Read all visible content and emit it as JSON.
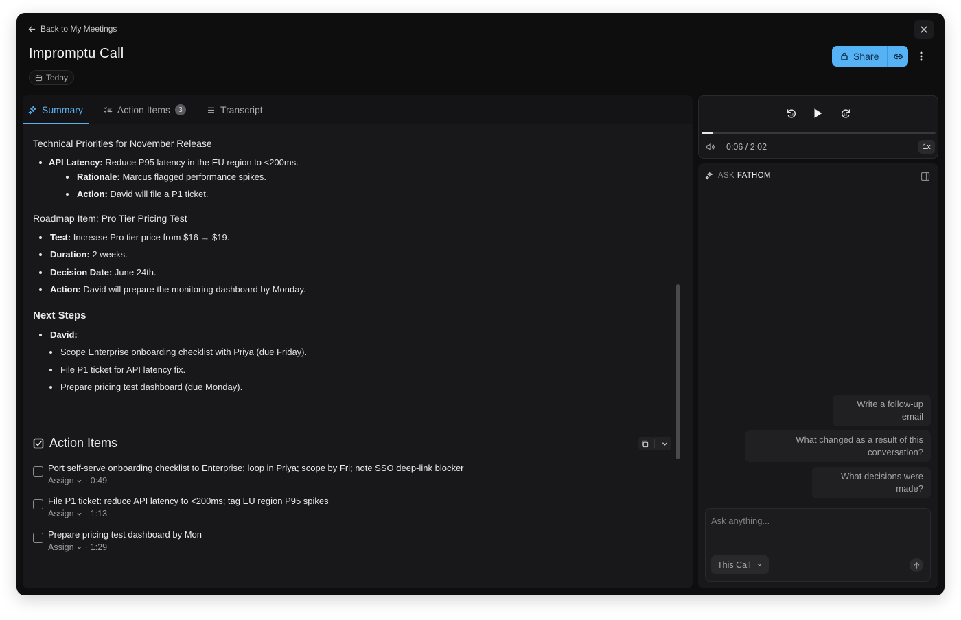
{
  "header": {
    "back_label": "Back to My Meetings",
    "title": "Impromptu Call",
    "date_chip": "Today",
    "share_label": "Share"
  },
  "tabs": [
    {
      "label": "Summary",
      "icon": "sparkle-icon",
      "active": true
    },
    {
      "label": "Action Items",
      "icon": "checklist-icon",
      "badge": "3"
    },
    {
      "label": "Transcript",
      "icon": "lines-icon"
    }
  ],
  "summary": {
    "sections": [
      {
        "heading": "Technical Priorities for November Release",
        "items": [
          {
            "bold": "API Latency:",
            "text": " Reduce P95 latency in the EU region to <200ms."
          }
        ],
        "subitems": [
          {
            "bold": "Rationale:",
            "text": " Marcus flagged performance spikes."
          },
          {
            "bold": "Action:",
            "text": " David will file a P1 ticket."
          }
        ]
      },
      {
        "heading": "Roadmap Item: Pro Tier Pricing Test",
        "items": [
          {
            "bold": "Test:",
            "text": " Increase Pro tier price from $16 → $19."
          },
          {
            "bold": "Duration:",
            "text": " 2 weeks."
          },
          {
            "bold": "Decision Date:",
            "text": " June 24th."
          },
          {
            "bold": "Action:",
            "text": " David will prepare the monitoring dashboard by Monday."
          }
        ]
      },
      {
        "heading": "Next Steps",
        "items": [
          {
            "bold": "David:",
            "text": ""
          }
        ],
        "subitems": [
          {
            "bold": "",
            "text": "Scope Enterprise onboarding checklist with Priya (due Friday)."
          },
          {
            "bold": "",
            "text": "File P1 ticket for API latency fix."
          },
          {
            "bold": "",
            "text": "Prepare pricing test dashboard (due Monday)."
          }
        ]
      }
    ]
  },
  "action_items": {
    "heading": "Action Items",
    "items": [
      {
        "text": "Port self-serve onboarding checklist to Enterprise; loop in Priya; scope by Fri; note SSO deep-link blocker",
        "assign": "Assign",
        "sep": "·",
        "time": "0:49"
      },
      {
        "text": "File P1 ticket: reduce API latency to <200ms; tag EU region P95 spikes",
        "assign": "Assign",
        "sep": "·",
        "time": "1:13"
      },
      {
        "text": "Prepare pricing test dashboard by Mon",
        "assign": "Assign",
        "sep": "·",
        "time": "1:29"
      }
    ]
  },
  "player": {
    "time": "0:06 / 2:02",
    "speed": "1x",
    "progress": 0.05
  },
  "ask": {
    "label": "ASK",
    "brand": "FATHOM",
    "suggestions": [
      "Write a follow-up email",
      "What changed as a result of this conversation?",
      "What decisions were made?"
    ],
    "placeholder": "Ask anything...",
    "scope": "This Call"
  },
  "colors": {
    "accent": "#5aafef",
    "share_bg": "#55b3f5",
    "window_bg": "#0e0e0f",
    "panel_bg": "#18181a"
  }
}
